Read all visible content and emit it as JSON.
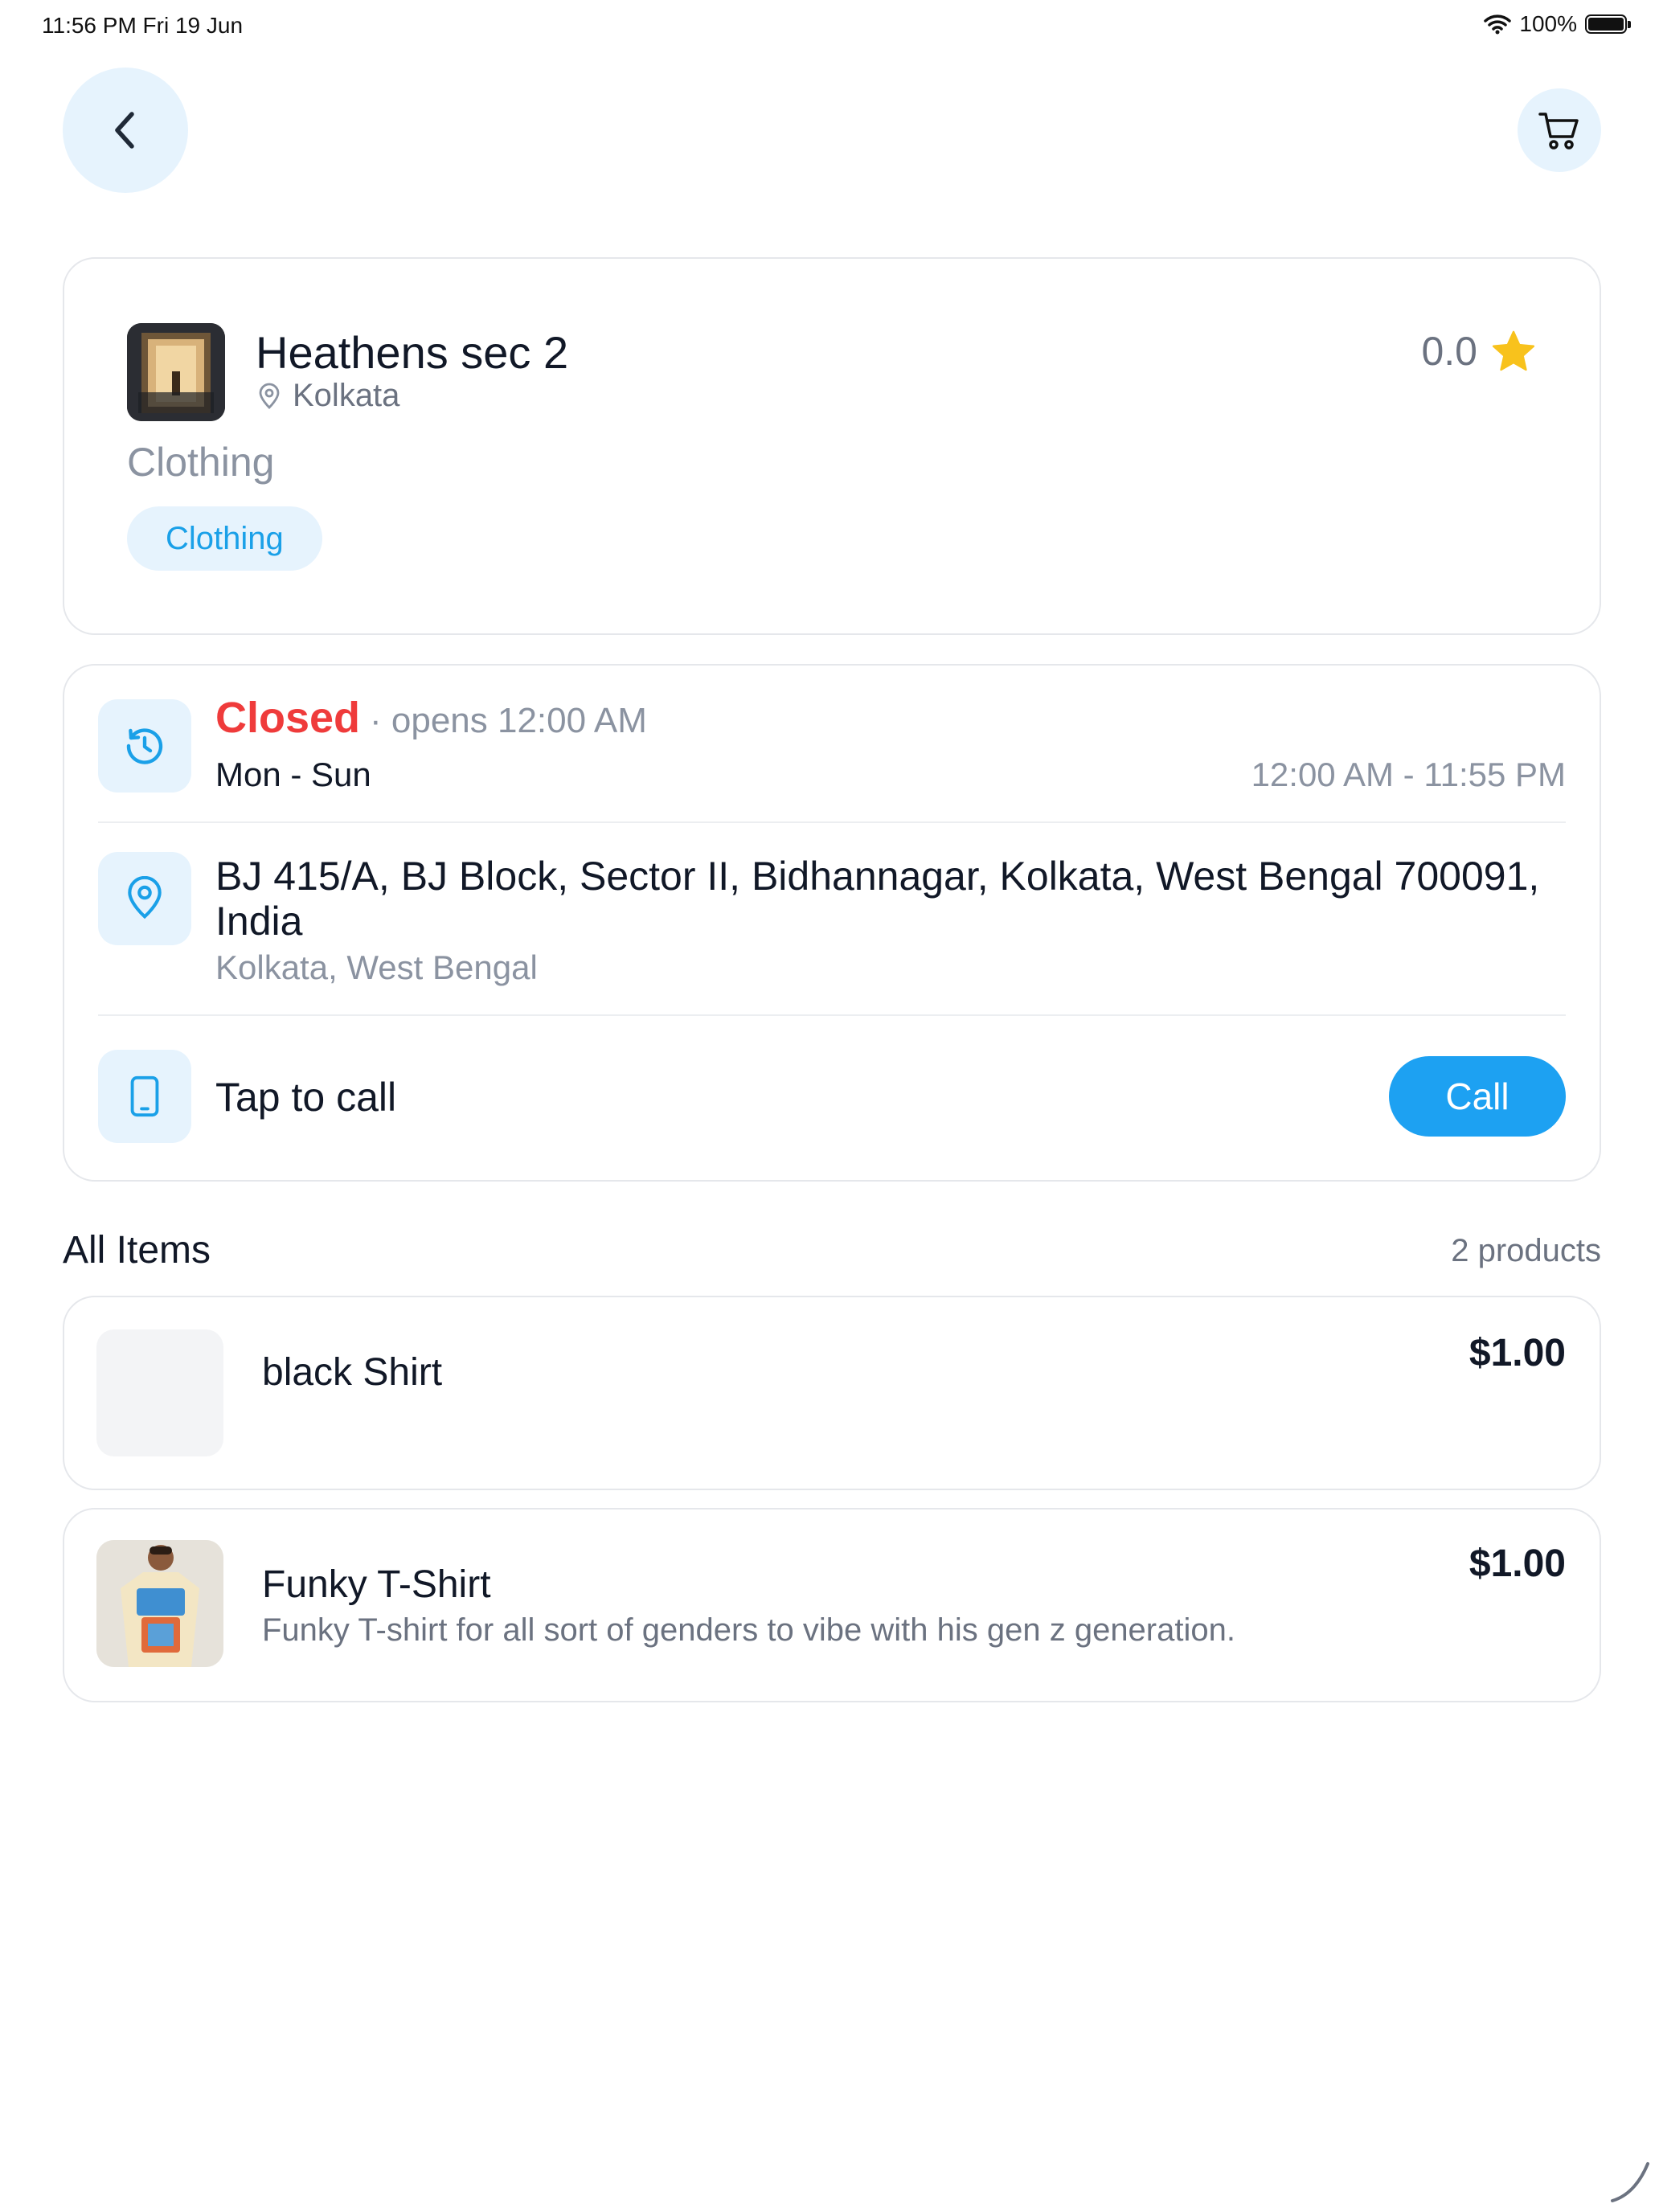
{
  "status_bar": {
    "time_date": "11:56 PM   Fri 19 Jun",
    "battery": "100%"
  },
  "store": {
    "name": "Heathens sec 2",
    "city": "Kolkata",
    "rating": "0.0",
    "category": "Clothing",
    "tag": "Clothing"
  },
  "hours": {
    "status": "Closed",
    "opens": "· opens 12:00 AM",
    "days": "Mon - Sun",
    "range": "12:00 AM - 11:55 PM"
  },
  "address": {
    "line": "BJ 415/A, BJ Block, Sector II, Bidhannagar, Kolkata, West Bengal 700091, India",
    "region": "Kolkata, West Bengal"
  },
  "contact": {
    "prompt": "Tap to call",
    "call_label": "Call"
  },
  "items_section": {
    "title": "All Items",
    "count": "2 products"
  },
  "products": [
    {
      "name": "black Shirt",
      "description": "",
      "price": "$1.00"
    },
    {
      "name": "Funky T-Shirt",
      "description": "Funky T-shirt for all sort of genders to vibe with his gen z generation.",
      "price": "$1.00"
    }
  ],
  "colors": {
    "accent": "#1da1f2",
    "accent_soft": "#e6f3fd",
    "closed_red": "#ef3b3b",
    "star": "#f8c21c"
  },
  "icons": {
    "back": "chevron-left-icon",
    "cart": "cart-icon",
    "location": "location-pin-icon",
    "star": "star-icon",
    "clock": "clock-history-icon",
    "phone": "phone-icon"
  }
}
